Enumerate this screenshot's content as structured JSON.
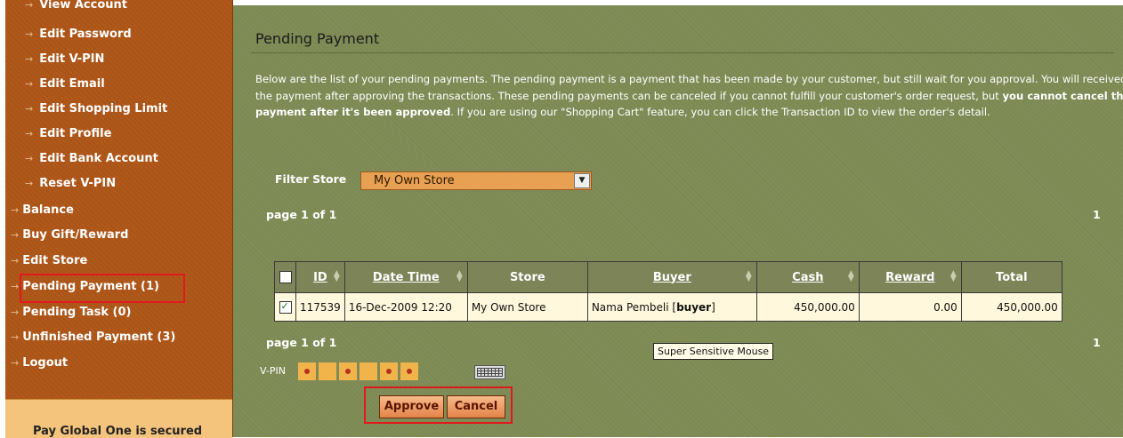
{
  "sidebar": {
    "items": [
      {
        "label": "View Account",
        "level": "sub"
      },
      {
        "label": "Edit Password",
        "level": "sub"
      },
      {
        "label": "Edit V-PIN",
        "level": "sub"
      },
      {
        "label": "Edit Email",
        "level": "sub"
      },
      {
        "label": "Edit Shopping Limit",
        "level": "sub"
      },
      {
        "label": "Edit Profile",
        "level": "sub"
      },
      {
        "label": "Edit Bank Account",
        "level": "sub"
      },
      {
        "label": "Reset V-PIN",
        "level": "sub"
      },
      {
        "label": "Balance",
        "level": "top"
      },
      {
        "label": "Buy Gift/Reward",
        "level": "top"
      },
      {
        "label": "Edit Store",
        "level": "top"
      },
      {
        "label": "Pending Payment (1)",
        "level": "top",
        "highlighted": true
      },
      {
        "label": "Pending Task (0)",
        "level": "top"
      },
      {
        "label": "Unfinished Payment (3)",
        "level": "top"
      },
      {
        "label": "Logout",
        "level": "top"
      }
    ],
    "secured_text": "Pay Global One is secured"
  },
  "main": {
    "title": "Pending Payment",
    "description": {
      "part1": "Below are the list of your pending payments. The pending payment is a payment that has been made by your customer, but still wait for you approval. You will received the payment after approving the transactions. These pending payments can be canceled if you cannot fulfill your customer's order request, but ",
      "bold": "you cannot cancel the payment after it's been approved",
      "part2": ". If you are using our \"Shopping Cart\" feature, you can click the Transaction ID to view the order's detail."
    },
    "filter": {
      "label": "Filter Store",
      "selected": "My Own Store"
    },
    "pagination": {
      "page_text": "page 1 of 1",
      "page_number": "1"
    },
    "table": {
      "headers": {
        "id": "ID",
        "datetime": "Date Time",
        "store": "Store",
        "buyer": "Buyer",
        "cash": "Cash",
        "reward": "Reward",
        "total": "Total"
      },
      "rows": [
        {
          "checked": true,
          "id": "117539",
          "datetime": "16-Dec-2009 12:20",
          "store": "My Own Store",
          "buyer_name": "Nama Pembeli",
          "buyer_user": "buyer",
          "cash": "450,000.00",
          "reward": "0.00",
          "total": "450,000.00"
        }
      ]
    },
    "tooltip": "Super Sensitive Mouse",
    "vpin_label": "V-PIN",
    "vpin_boxes": [
      true,
      false,
      true,
      false,
      true,
      true
    ],
    "buttons": {
      "approve": "Approve",
      "cancel": "Cancel"
    }
  },
  "colors": {
    "sidebar_bg": "#b0581a",
    "main_bg": "#7e8a54",
    "highlight": "#e2191c",
    "row_bg": "#fff8dc"
  }
}
